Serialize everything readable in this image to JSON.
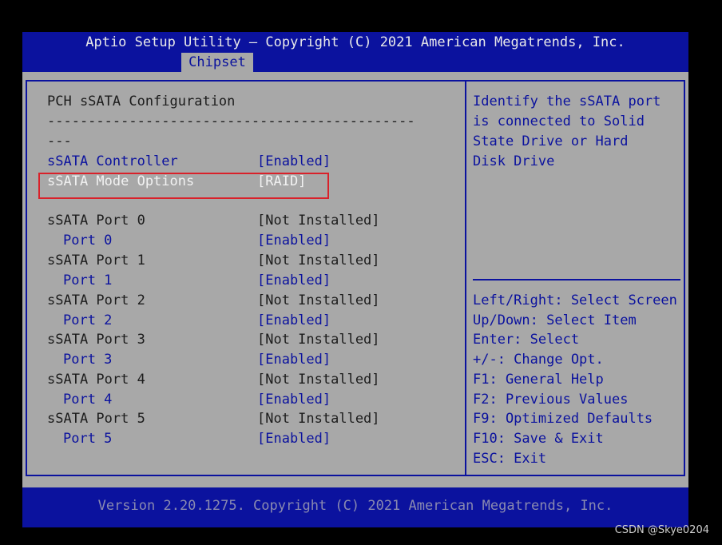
{
  "header": {
    "title": "Aptio Setup Utility – Copyright (C) 2021 American Megatrends, Inc.",
    "active_tab": "Chipset"
  },
  "main": {
    "section_title": "PCH sSATA Configuration",
    "divider_line1": "---------------------------------------------",
    "divider_line2": "---",
    "controller": {
      "label": "sSATA Controller",
      "value": "[Enabled]"
    },
    "mode": {
      "label": "sSATA Mode Options",
      "value": "[RAID]"
    },
    "ports": [
      {
        "label": "sSATA Port 0",
        "status": "[Not Installed]",
        "sub_label": "Port 0",
        "sub_value": "[Enabled]"
      },
      {
        "label": "sSATA Port 1",
        "status": "[Not Installed]",
        "sub_label": "Port 1",
        "sub_value": "[Enabled]"
      },
      {
        "label": "sSATA Port 2",
        "status": "[Not Installed]",
        "sub_label": "Port 2",
        "sub_value": "[Enabled]"
      },
      {
        "label": "sSATA Port 3",
        "status": "[Not Installed]",
        "sub_label": "Port 3",
        "sub_value": "[Enabled]"
      },
      {
        "label": "sSATA Port 4",
        "status": "[Not Installed]",
        "sub_label": "Port 4",
        "sub_value": "[Enabled]"
      },
      {
        "label": "sSATA Port 5",
        "status": "[Not Installed]",
        "sub_label": "Port 5",
        "sub_value": "[Enabled]"
      }
    ]
  },
  "help": {
    "description": [
      "Identify the sSATA port",
      "is connected to Solid",
      "State Drive or Hard",
      "Disk Drive"
    ],
    "keys": [
      "Left/Right: Select Screen",
      "Up/Down: Select Item",
      "Enter: Select",
      "+/-: Change Opt.",
      "F1: General Help",
      "F2: Previous Values",
      "F9: Optimized Defaults",
      "F10: Save & Exit",
      "ESC: Exit"
    ]
  },
  "footer": {
    "text": "Version 2.20.1275. Copyright (C) 2021 American Megatrends, Inc."
  },
  "watermark": "CSDN @Skye0204",
  "colors": {
    "bios_blue": "#0b129e",
    "panel_gray": "#a8a8a8",
    "highlight_red": "#d9212a"
  }
}
